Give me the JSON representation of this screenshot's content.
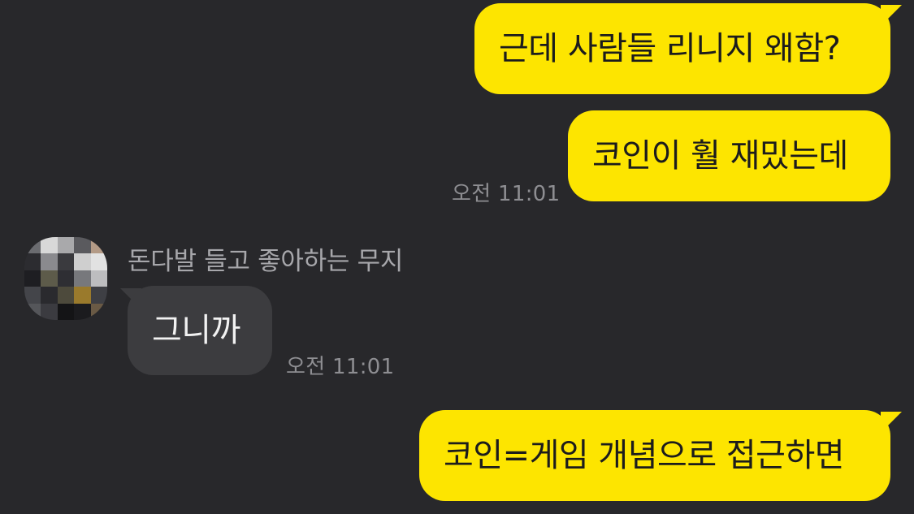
{
  "chat": {
    "messages": [
      {
        "id": "m1",
        "direction": "out",
        "text": "근데 사람들 리니지 왜함?"
      },
      {
        "id": "m2",
        "direction": "out",
        "text": "코인이 훨 재밌는데",
        "time": "오전 11:01"
      },
      {
        "id": "m3",
        "direction": "in",
        "sender": "돈다발 들고 좋아하는 무지",
        "text": "그니까",
        "time": "오전 11:01"
      },
      {
        "id": "m4",
        "direction": "out",
        "text": "코인=게임 개념으로 접근하면"
      }
    ]
  },
  "colors": {
    "background": "#28282b",
    "outgoing_bubble": "#fde500",
    "incoming_bubble": "#3c3c3f",
    "timestamp": "#8e8e92",
    "sender_name": "#a7a7ab"
  },
  "icons": {
    "avatar": "pixelated-profile-avatar-icon"
  }
}
